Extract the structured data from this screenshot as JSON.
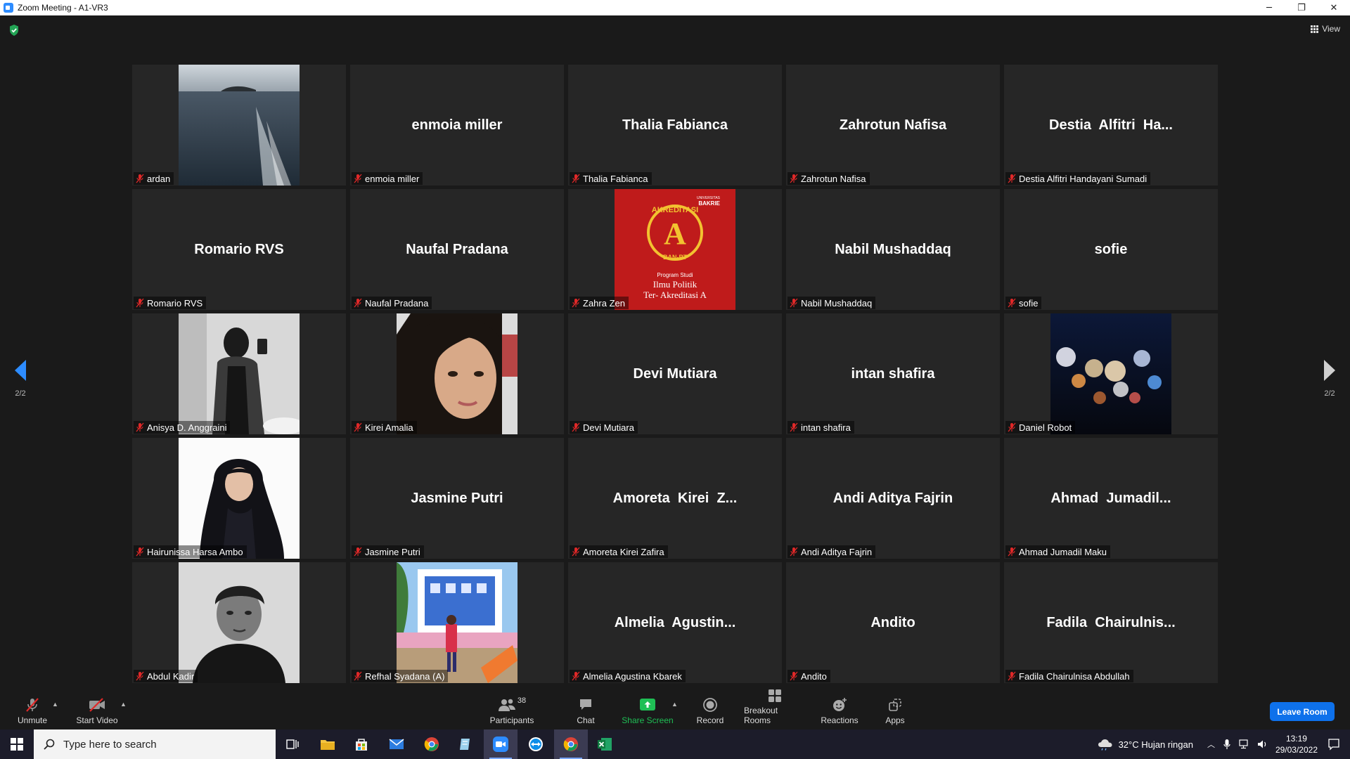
{
  "window": {
    "title": "Zoom Meeting - A1-VR3"
  },
  "top_bar": {
    "view_label": "View"
  },
  "pager": {
    "left_label": "2/2",
    "right_label": "2/2"
  },
  "participants": [
    {
      "name": "ardan",
      "tile_text": "",
      "video": "sea"
    },
    {
      "name": "enmoia miller",
      "tile_text": "enmoia miller",
      "video": ""
    },
    {
      "name": "Thalia Fabianca",
      "tile_text": "Thalia Fabianca",
      "video": ""
    },
    {
      "name": "Zahrotun Nafisa",
      "tile_text": "Zahrotun Nafisa",
      "video": ""
    },
    {
      "name": "Destia Alfitri Handayani Sumadi",
      "tile_text": "Destia  Alfitri  Ha...",
      "video": ""
    },
    {
      "name": "Romario RVS",
      "tile_text": "Romario RVS",
      "video": ""
    },
    {
      "name": "Naufal Pradana",
      "tile_text": "Naufal Pradana",
      "video": ""
    },
    {
      "name": "Zahra Zen",
      "tile_text": "",
      "video": "poster"
    },
    {
      "name": "Nabil Mushaddaq",
      "tile_text": "Nabil Mushaddaq",
      "video": ""
    },
    {
      "name": "sofie",
      "tile_text": "sofie",
      "video": ""
    },
    {
      "name": "Anisya D. Anggraini",
      "tile_text": "",
      "video": "mirror"
    },
    {
      "name": "Kirei Amalia",
      "tile_text": "",
      "video": "face"
    },
    {
      "name": "Devi Mutiara",
      "tile_text": "Devi Mutiara",
      "video": ""
    },
    {
      "name": "intan shafira",
      "tile_text": "intan shafira",
      "video": ""
    },
    {
      "name": "Daniel Robot",
      "tile_text": "",
      "video": "bokeh"
    },
    {
      "name": "Hairunissa Harsa Ambo",
      "tile_text": "",
      "video": "hijab"
    },
    {
      "name": "Jasmine Putri",
      "tile_text": "Jasmine Putri",
      "video": ""
    },
    {
      "name": "Amoreta Kirei Zafira",
      "tile_text": "Amoreta  Kirei  Z...",
      "video": ""
    },
    {
      "name": "Andi Aditya Fajrin",
      "tile_text": "Andi Aditya Fajrin",
      "video": ""
    },
    {
      "name": "Ahmad Jumadil Maku",
      "tile_text": "Ahmad  Jumadil...",
      "video": ""
    },
    {
      "name": "Abdul Kadir",
      "tile_text": "",
      "video": "bw"
    },
    {
      "name": "Refhal Syadana (A)",
      "tile_text": "",
      "video": "field"
    },
    {
      "name": "Almelia Agustina Kbarek",
      "tile_text": "Almelia  Agustin...",
      "video": ""
    },
    {
      "name": "Andito",
      "tile_text": "Andito",
      "video": ""
    },
    {
      "name": "Fadila Chairulnisa Abdullah",
      "tile_text": "Fadila  Chairulnis...",
      "video": ""
    }
  ],
  "poster": {
    "brand_top": "UNIVERSITAS",
    "brand": "BAKRIE",
    "ring_text": "AKREDITASI",
    "grade": "A",
    "agency": "BAN-PT",
    "line1": "Program Studi",
    "line2": "Ilmu Politik",
    "line3": "Ter- Akreditasi A"
  },
  "toolbar": {
    "unmute": "Unmute",
    "start_video": "Start Video",
    "participants": "Participants",
    "participants_count": "38",
    "chat": "Chat",
    "share_screen": "Share Screen",
    "record": "Record",
    "breakout_rooms": "Breakout Rooms",
    "reactions": "Reactions",
    "apps": "Apps",
    "leave": "Leave Room"
  },
  "taskbar": {
    "search_placeholder": "Type here to search",
    "weather": "32°C  Hujan ringan",
    "time": "13:19",
    "date": "29/03/2022"
  },
  "colors": {
    "accent": "#2d8cff",
    "leave": "#0e71eb",
    "muted": "#e02828",
    "share": "#1fbf55"
  }
}
